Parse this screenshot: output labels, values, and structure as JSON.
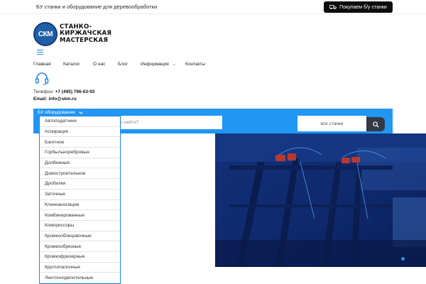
{
  "topbar": {
    "tagline": "БУ станки и оборудование для деревообработки",
    "buy_button": "Покупаем б/у станки"
  },
  "logo": {
    "badge": "СКМ",
    "line1": "СТАНКО-",
    "line2": "КИРЖАЧСКАЯ",
    "line3": "МАСТЕРСКАЯ"
  },
  "nav": {
    "items": [
      {
        "label": "Главная"
      },
      {
        "label": "Каталог"
      },
      {
        "label": "О нас"
      },
      {
        "label": "Блог"
      },
      {
        "label": "Информация"
      },
      {
        "label": "Контакты"
      }
    ]
  },
  "contacts": {
    "phone_label": "Телефон:",
    "phone": "+7 (495) 796-63-93",
    "email_label": "Email:",
    "email": "info@skm.ru"
  },
  "search": {
    "category_trigger": "БУ оборудование",
    "placeholder_visible": "е найти?",
    "category_select": "все станки"
  },
  "dropdown": {
    "items": [
      "Автоподатчики",
      "Аспирация",
      "Багетное",
      "Горбыльноребровые",
      "Долбежные",
      "Домостроительное",
      "Дробилки",
      "Заточные",
      "Клеенаносящие",
      "Комбинированные",
      "Компрессоры",
      "Кромкооблицовочные",
      "Кромкообрезные",
      "Кромкофрезерные",
      "Круглопалочные",
      "Ленточноделительные"
    ]
  },
  "colors": {
    "accent": "#2196f3",
    "dark_button": "#0d0d0d",
    "hero_tint": "#0e2b74"
  },
  "icons": {
    "truck": "truck-icon",
    "headset": "headset-icon",
    "search": "search-icon",
    "menu": "hamburger-menu-icon",
    "chevron": "chevron-down-icon"
  }
}
